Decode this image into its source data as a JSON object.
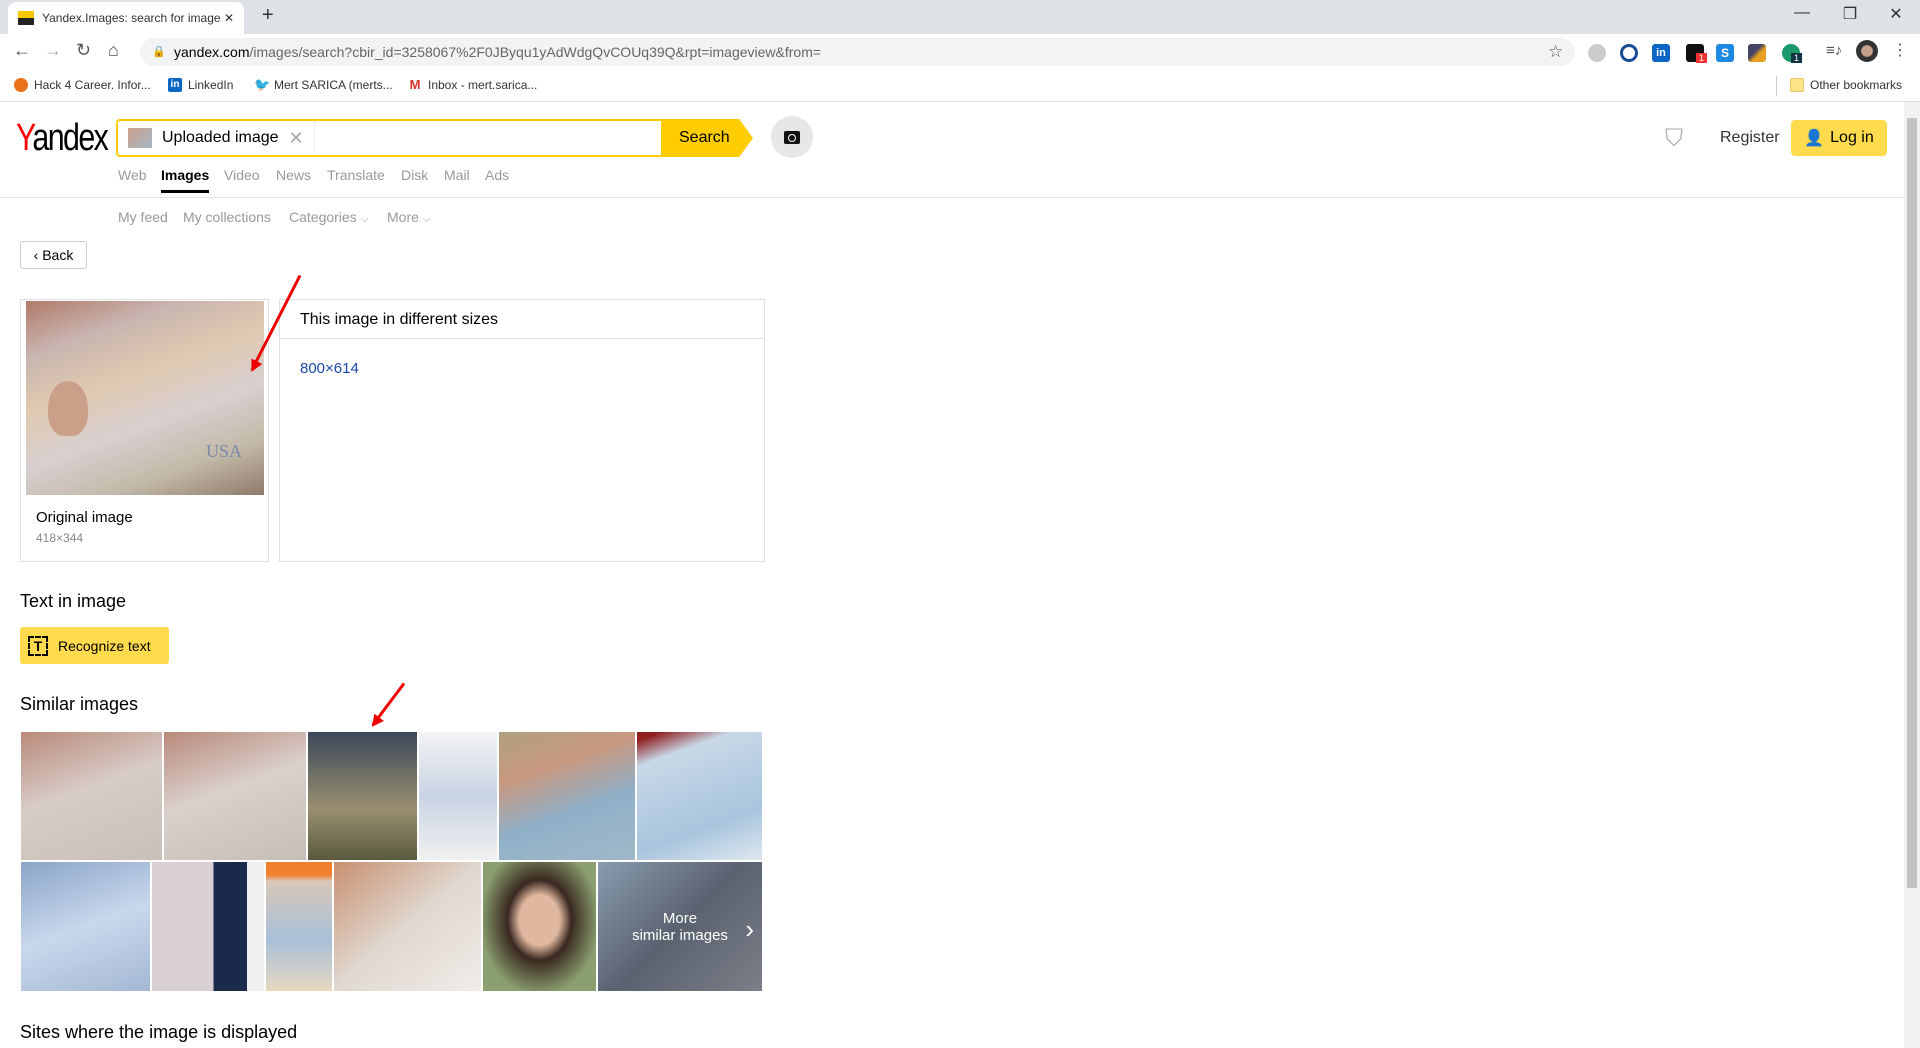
{
  "browser": {
    "tab_title": "Yandex.Images: search for image",
    "url_host": "yandex.com",
    "url_path": "/images/search?cbir_id=3258067%2F0JByqu1yAdWdgQvCOUq39Q&rpt=imageview&from=",
    "bookmarks": [
      {
        "label": "Hack 4 Career. Infor...",
        "color": "#e8711a"
      },
      {
        "label": "LinkedIn",
        "color": "#0a66c2"
      },
      {
        "label": "Mert SARICA (merts...",
        "color": "#1da1f2"
      },
      {
        "label": "Inbox - mert.sarica...",
        "color": "#d93025"
      }
    ],
    "other_bookmarks": "Other bookmarks",
    "extension_badges": [
      "1",
      "1"
    ]
  },
  "header": {
    "logo": [
      "Y",
      "andex"
    ],
    "search_chip": "Uploaded image",
    "search_button": "Search",
    "services": [
      "Web",
      "Images",
      "Video",
      "News",
      "Translate",
      "Disk",
      "Mail",
      "Ads"
    ],
    "active_service": "Images",
    "register": "Register",
    "login": "Log in"
  },
  "subnav": {
    "items": [
      "My feed",
      "My collections",
      "Categories",
      "More"
    ]
  },
  "back": "Back",
  "original": {
    "label": "Original image",
    "size": "418×344"
  },
  "sizes": {
    "title": "This image in different sizes",
    "links": [
      "800×614"
    ]
  },
  "text_in_image": {
    "title": "Text in image",
    "button": "Recognize text"
  },
  "similar": {
    "title": "Similar images",
    "more": [
      "More",
      "similar images"
    ]
  },
  "sites": {
    "title": "Sites where the image is displayed"
  },
  "colors": {
    "accent": "#ffcc00",
    "login": "#ffdb4d",
    "link": "#1a47a8",
    "annotation_arrow": "#ee0000"
  }
}
